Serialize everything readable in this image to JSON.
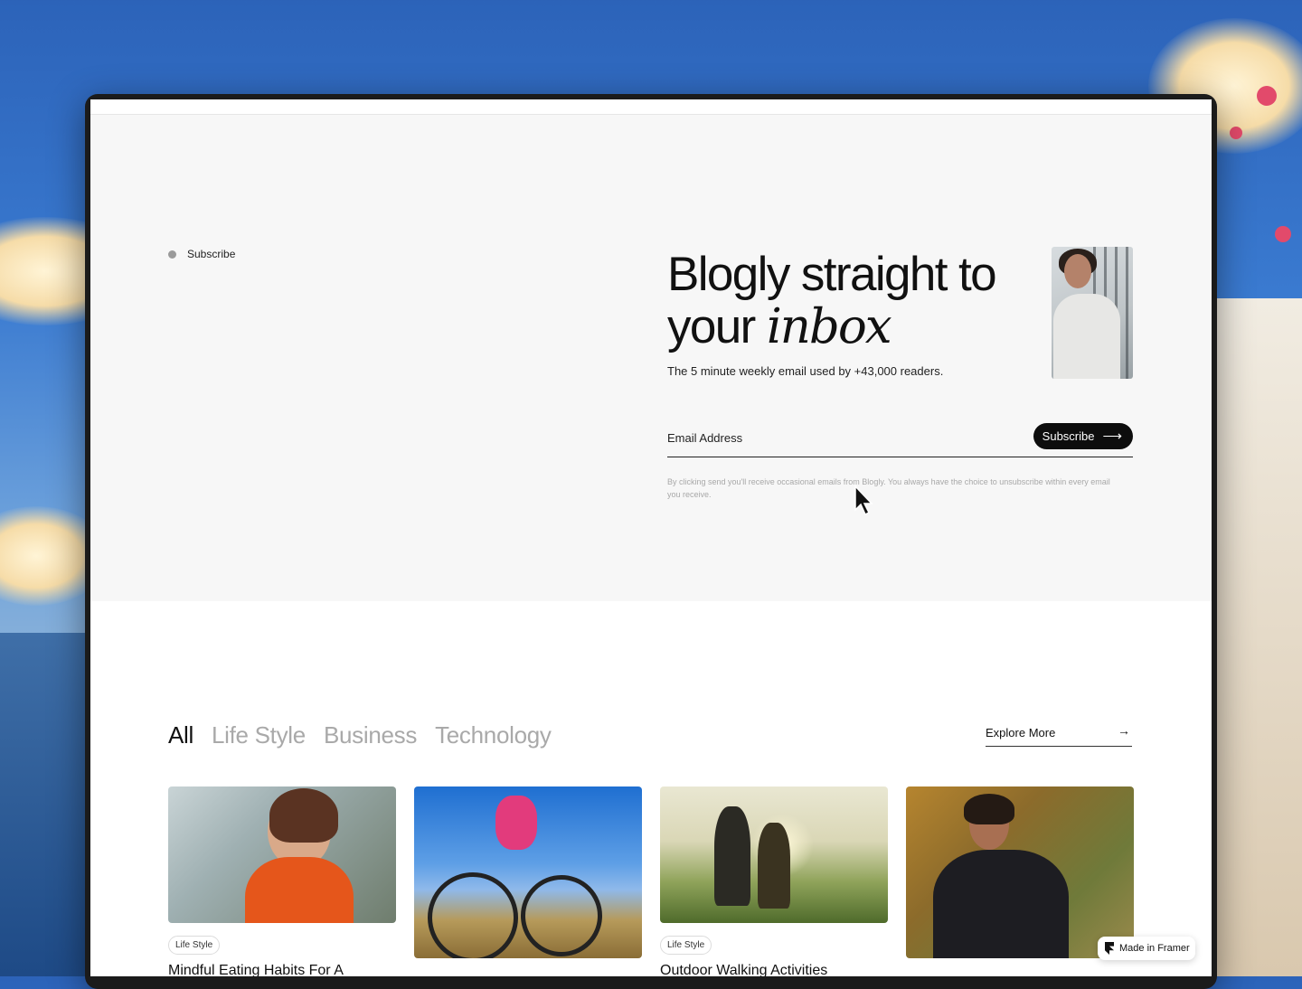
{
  "hero": {
    "eyebrow": "Subscribe",
    "headline_plain": "Blogly straight to your ",
    "headline_italic": "inbox",
    "subtitle": "The 5 minute weekly email used by +43,000 readers.",
    "email_placeholder": "Email Address",
    "subscribe_label": "Subscribe",
    "fine_print": "By clicking send you'll receive occasional emails from Blogly. You always have the choice to unsubscribe within every email you receive."
  },
  "filters": {
    "tabs": [
      {
        "label": "All",
        "active": true
      },
      {
        "label": "Life Style",
        "active": false
      },
      {
        "label": "Business",
        "active": false
      },
      {
        "label": "Technology",
        "active": false
      }
    ],
    "explore_label": "Explore More"
  },
  "cards": [
    {
      "tag": "Life Style",
      "title": "Mindful Eating Habits For A"
    },
    {
      "tag": "",
      "title": ""
    },
    {
      "tag": "Life Style",
      "title": "Outdoor Walking Activities"
    },
    {
      "tag": "",
      "title": ""
    }
  ],
  "badge": {
    "label": "Made in Framer"
  },
  "colors": {
    "accent": "#0d0d0d",
    "hero_bg": "#f7f7f7",
    "muted_tab": "#a9a9a9"
  },
  "icons": {
    "arrow": "arrow-right-icon",
    "framer": "framer-logo-icon",
    "cursor": "mouse-pointer-icon"
  }
}
